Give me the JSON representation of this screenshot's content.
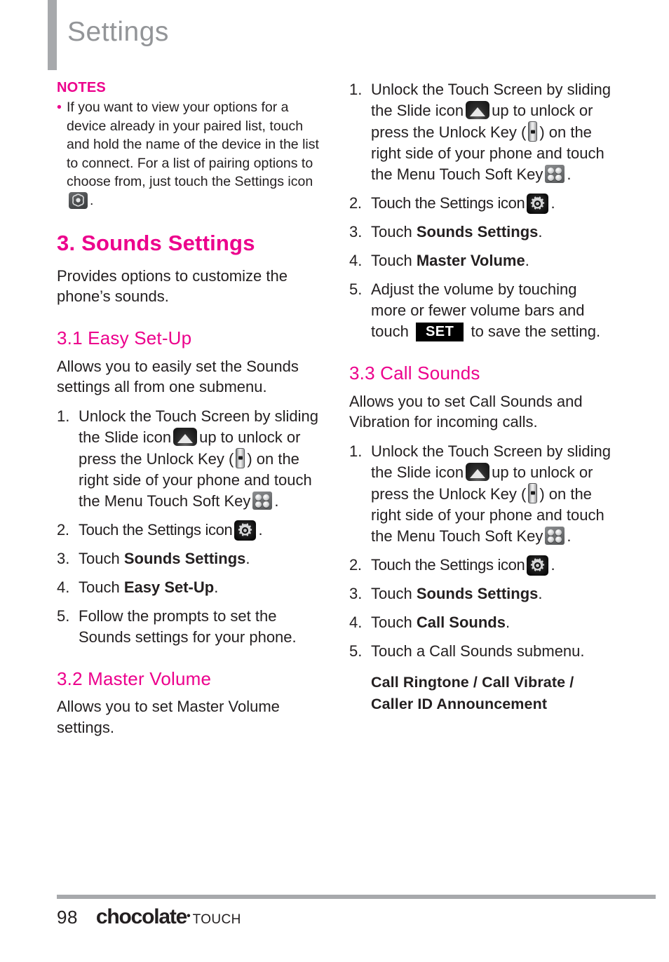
{
  "header": {
    "title": "Settings"
  },
  "notes": {
    "title": "NOTES",
    "bullet": "•",
    "items": [
      "If you want to view your options for a device already in your paired list, touch and hold the name of the device in the list to connect. For a list of pairing options to choose from, just touch the Settings icon"
    ],
    "trailing_period": "."
  },
  "sections": {
    "sounds_settings": {
      "heading": "3. Sounds Settings",
      "intro": "Provides options to customize the phone’s sounds."
    },
    "easy_setup": {
      "heading": "3.1 Easy Set-Up",
      "intro": "Allows you to easily set the Sounds settings all from one submenu.",
      "steps": [
        {
          "num": "1.",
          "part1": "Unlock the Touch Screen by sliding the Slide icon",
          "part2": "up to unlock or press the Unlock Key (",
          "part3": ") on the right side of your phone and touch the Menu Touch Soft Key",
          "part4": "."
        },
        {
          "num": "2.",
          "part1": "Touch the Settings icon",
          "part4": "."
        },
        {
          "num": "3.",
          "pre": "Touch ",
          "bold": "Sounds Settings",
          "post": "."
        },
        {
          "num": "4.",
          "pre": "Touch ",
          "bold": "Easy Set-Up",
          "post": "."
        },
        {
          "num": "5.",
          "text": "Follow the prompts to set the Sounds settings for your phone."
        }
      ]
    },
    "master_volume": {
      "heading": "3.2 Master Volume",
      "intro": "Allows you to set Master Volume settings.",
      "steps": [
        {
          "num": "1.",
          "part1": "Unlock the Touch Screen by sliding the Slide icon",
          "part2": "up to unlock or press the Unlock Key (",
          "part3": ") on the right side of your phone and touch the Menu Touch Soft Key",
          "part4": "."
        },
        {
          "num": "2.",
          "part1": "Touch the Settings icon",
          "part4": "."
        },
        {
          "num": "3.",
          "pre": "Touch ",
          "bold": "Sounds Settings",
          "post": "."
        },
        {
          "num": "4.",
          "pre": "Touch ",
          "bold": "Master Volume",
          "post": "."
        },
        {
          "num": "5.",
          "pre": "Adjust the volume by touching more or fewer volume bars and touch ",
          "button": "SET",
          "post": " to save the setting."
        }
      ]
    },
    "call_sounds": {
      "heading": "3.3 Call Sounds",
      "intro": "Allows you to set Call Sounds and Vibration for incoming calls.",
      "steps": [
        {
          "num": "1.",
          "part1": "Unlock the Touch Screen by sliding the Slide icon",
          "part2": "up to unlock or press the Unlock Key (",
          "part3": ") on the right side of your phone and touch the Menu Touch Soft Key",
          "part4": "."
        },
        {
          "num": "2.",
          "part1": "Touch the Settings icon",
          "part4": "."
        },
        {
          "num": "3.",
          "pre": "Touch ",
          "bold": "Sounds Settings",
          "post": "."
        },
        {
          "num": "4.",
          "pre": "Touch ",
          "bold": "Call Sounds",
          "post": "."
        },
        {
          "num": "5.",
          "text": "Touch a Call Sounds submenu."
        }
      ],
      "submenu_line1": "Call Ringtone / Call Vibrate /",
      "submenu_line2": "Caller ID Announcement"
    }
  },
  "footer": {
    "page_number": "98",
    "brand": "chocolate",
    "brand_registered": "•",
    "brand_suffix": "TOUCH"
  },
  "colors": {
    "accent_pink": "#ec008c",
    "header_gray": "#939598",
    "rule_gray": "#a7a9ac",
    "body_text": "#231f20"
  },
  "icons": {
    "slide": "slide-up-icon",
    "unlock_key": "unlock-key-icon",
    "menu_soft_key": "menu-touch-soft-key-icon",
    "settings_gear": "settings-gear-icon",
    "settings_flower": "settings-flower-icon"
  }
}
